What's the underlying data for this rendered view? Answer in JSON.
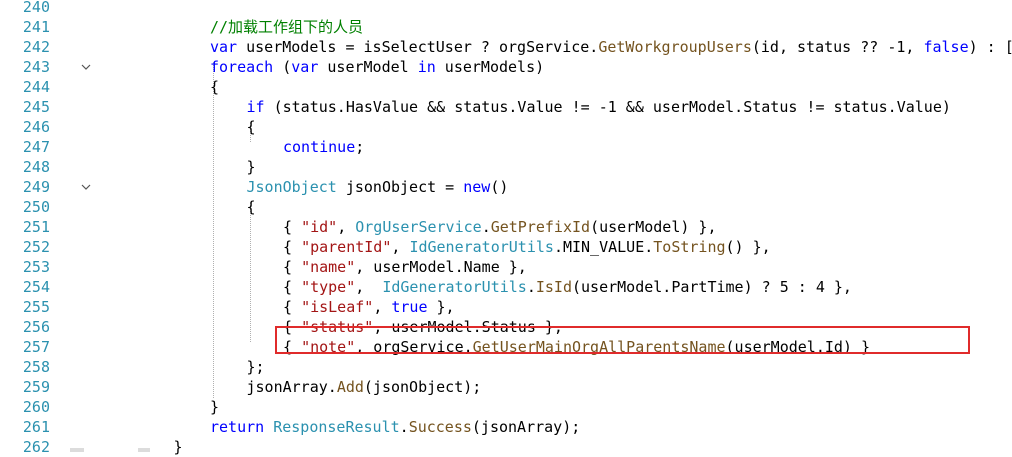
{
  "editor": {
    "lines": [
      {
        "num": "240",
        "fold": false,
        "indent": 0,
        "tokens": []
      },
      {
        "num": "241",
        "fold": false,
        "indent": 0,
        "tokens": [
          {
            "t": "cm",
            "v": "//加载工作组下的人员"
          }
        ]
      },
      {
        "num": "242",
        "fold": false,
        "indent": 0,
        "tokens": [
          {
            "t": "kw",
            "v": "var"
          },
          {
            "t": "p",
            "v": " userModels = isSelectUser ? orgService."
          },
          {
            "t": "fn",
            "v": "GetWorkgroupUsers"
          },
          {
            "t": "p",
            "v": "(id, status ?? -1, "
          },
          {
            "t": "kw",
            "v": "false"
          },
          {
            "t": "p",
            "v": ") : ["
          }
        ]
      },
      {
        "num": "243",
        "fold": true,
        "indent": 0,
        "tokens": [
          {
            "t": "kw",
            "v": "foreach"
          },
          {
            "t": "p",
            "v": " ("
          },
          {
            "t": "kw",
            "v": "var"
          },
          {
            "t": "p",
            "v": " userModel "
          },
          {
            "t": "kw",
            "v": "in"
          },
          {
            "t": "p",
            "v": " userModels)"
          }
        ]
      },
      {
        "num": "244",
        "fold": false,
        "indent": 0,
        "tokens": [
          {
            "t": "p",
            "v": "{"
          }
        ]
      },
      {
        "num": "245",
        "fold": false,
        "indent": 1,
        "tokens": [
          {
            "t": "kw",
            "v": "if"
          },
          {
            "t": "p",
            "v": " (status.HasValue && status.Value != -1 && userModel.Status != status.Value)"
          }
        ]
      },
      {
        "num": "246",
        "fold": false,
        "indent": 1,
        "tokens": [
          {
            "t": "p",
            "v": "{"
          }
        ]
      },
      {
        "num": "247",
        "fold": false,
        "indent": 2,
        "tokens": [
          {
            "t": "kw",
            "v": "continue"
          },
          {
            "t": "p",
            "v": ";"
          }
        ]
      },
      {
        "num": "248",
        "fold": false,
        "indent": 1,
        "tokens": [
          {
            "t": "p",
            "v": "}"
          }
        ]
      },
      {
        "num": "249",
        "fold": true,
        "indent": 1,
        "tokens": [
          {
            "t": "ty",
            "v": "JsonObject"
          },
          {
            "t": "p",
            "v": " jsonObject = "
          },
          {
            "t": "kw",
            "v": "new"
          },
          {
            "t": "p",
            "v": "()"
          }
        ]
      },
      {
        "num": "250",
        "fold": false,
        "indent": 1,
        "tokens": [
          {
            "t": "p",
            "v": "{"
          }
        ]
      },
      {
        "num": "251",
        "fold": false,
        "indent": 2,
        "tokens": [
          {
            "t": "p",
            "v": "{ "
          },
          {
            "t": "str",
            "v": "\"id\""
          },
          {
            "t": "p",
            "v": ", "
          },
          {
            "t": "ty",
            "v": "OrgUserService"
          },
          {
            "t": "p",
            "v": "."
          },
          {
            "t": "fn",
            "v": "GetPrefixId"
          },
          {
            "t": "p",
            "v": "(userModel) },"
          }
        ]
      },
      {
        "num": "252",
        "fold": false,
        "indent": 2,
        "tokens": [
          {
            "t": "p",
            "v": "{ "
          },
          {
            "t": "str",
            "v": "\"parentId\""
          },
          {
            "t": "p",
            "v": ", "
          },
          {
            "t": "ty",
            "v": "IdGeneratorUtils"
          },
          {
            "t": "p",
            "v": ".MIN_VALUE."
          },
          {
            "t": "fn",
            "v": "ToString"
          },
          {
            "t": "p",
            "v": "() },"
          }
        ]
      },
      {
        "num": "253",
        "fold": false,
        "indent": 2,
        "tokens": [
          {
            "t": "p",
            "v": "{ "
          },
          {
            "t": "str",
            "v": "\"name\""
          },
          {
            "t": "p",
            "v": ", userModel.Name },"
          }
        ]
      },
      {
        "num": "254",
        "fold": false,
        "indent": 2,
        "tokens": [
          {
            "t": "p",
            "v": "{ "
          },
          {
            "t": "str",
            "v": "\"type\""
          },
          {
            "t": "p",
            "v": ",  "
          },
          {
            "t": "ty",
            "v": "IdGeneratorUtils"
          },
          {
            "t": "p",
            "v": "."
          },
          {
            "t": "fn",
            "v": "IsId"
          },
          {
            "t": "p",
            "v": "(userModel.PartTime) ? 5 : 4 },"
          }
        ]
      },
      {
        "num": "255",
        "fold": false,
        "indent": 2,
        "tokens": [
          {
            "t": "p",
            "v": "{ "
          },
          {
            "t": "str",
            "v": "\"isLeaf\""
          },
          {
            "t": "p",
            "v": ", "
          },
          {
            "t": "kw",
            "v": "true"
          },
          {
            "t": "p",
            "v": " },"
          }
        ]
      },
      {
        "num": "256",
        "fold": false,
        "indent": 2,
        "tokens": [
          {
            "t": "p",
            "v": "{ "
          },
          {
            "t": "str",
            "v": "\"status\""
          },
          {
            "t": "p",
            "v": ", userModel.Status },"
          }
        ]
      },
      {
        "num": "257",
        "fold": false,
        "indent": 2,
        "tokens": [
          {
            "t": "p",
            "v": "{ "
          },
          {
            "t": "str",
            "v": "\"note\""
          },
          {
            "t": "p",
            "v": ", orgService."
          },
          {
            "t": "fn",
            "v": "GetUserMainOrgAllParentsName"
          },
          {
            "t": "p",
            "v": "(userModel.Id) }"
          }
        ]
      },
      {
        "num": "258",
        "fold": false,
        "indent": 1,
        "tokens": [
          {
            "t": "p",
            "v": "};"
          }
        ]
      },
      {
        "num": "259",
        "fold": false,
        "indent": 1,
        "tokens": [
          {
            "t": "p",
            "v": "jsonArray."
          },
          {
            "t": "fn",
            "v": "Add"
          },
          {
            "t": "p",
            "v": "(jsonObject);"
          }
        ]
      },
      {
        "num": "260",
        "fold": false,
        "indent": 0,
        "tokens": [
          {
            "t": "p",
            "v": "}"
          }
        ]
      },
      {
        "num": "261",
        "fold": false,
        "indent": 0,
        "tokens": [
          {
            "t": "kw",
            "v": "return"
          },
          {
            "t": "p",
            "v": " "
          },
          {
            "t": "ty",
            "v": "ResponseResult"
          },
          {
            "t": "p",
            "v": "."
          },
          {
            "t": "fn",
            "v": "Success"
          },
          {
            "t": "p",
            "v": "(jsonArray);"
          }
        ]
      },
      {
        "num": "262",
        "fold": false,
        "indent": -1,
        "tokens": [
          {
            "t": "p",
            "v": "}"
          }
        ]
      }
    ],
    "highlighted_line": "257",
    "colors": {
      "keyword": "#0000ff",
      "type": "#2b91af",
      "method": "#74531f",
      "string": "#a31515",
      "comment": "#008000",
      "line_number": "#2b91af",
      "highlight_box": "#e02b2b"
    }
  }
}
